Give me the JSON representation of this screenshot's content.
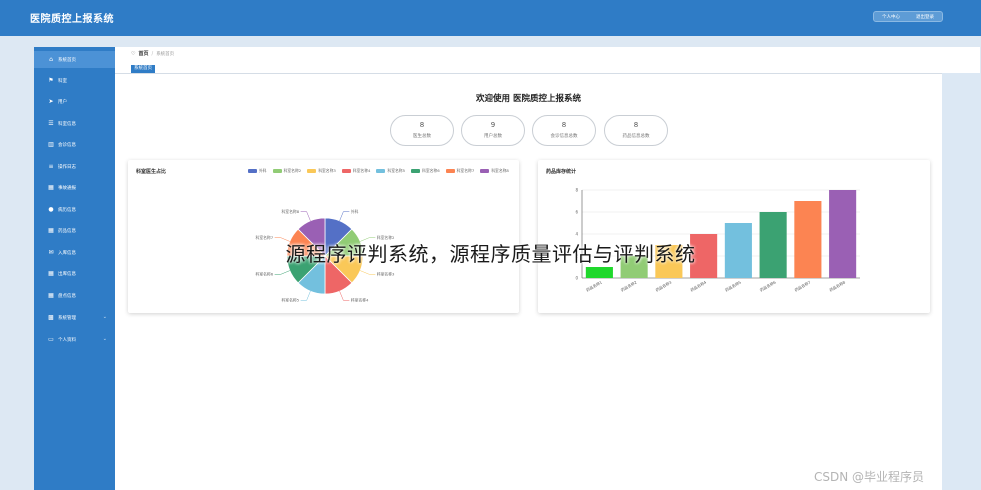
{
  "app": {
    "title": "医院质控上报系统"
  },
  "header": {
    "user_label": "个人中心",
    "logout_label": "退出登录"
  },
  "sidebar": {
    "items": [
      {
        "label": "系统首页",
        "icon": "home-icon"
      },
      {
        "label": "科室",
        "icon": "flag-icon"
      },
      {
        "label": "用户",
        "icon": "send-icon"
      },
      {
        "label": "科室信息",
        "icon": "list-icon"
      },
      {
        "label": "会诊信息",
        "icon": "chart-icon"
      },
      {
        "label": "操作日志",
        "icon": "log-icon"
      },
      {
        "label": "事故通报",
        "icon": "grid-icon"
      },
      {
        "label": "病历信息",
        "icon": "pin-icon"
      },
      {
        "label": "药品信息",
        "icon": "grid-icon"
      },
      {
        "label": "入库信息",
        "icon": "envelope-icon"
      },
      {
        "label": "出库信息",
        "icon": "grid-icon"
      },
      {
        "label": "盘点信息",
        "icon": "grid-icon"
      },
      {
        "label": "系统管理",
        "icon": "apps-icon"
      },
      {
        "label": "个人资料",
        "icon": "card-icon"
      }
    ]
  },
  "breadcrumb": {
    "home": "首页",
    "current": "系统首页"
  },
  "tab": {
    "label": "系统首页"
  },
  "welcome": "欢迎使用 医院质控上报系统",
  "stats": [
    {
      "value": "8",
      "label": "医生总数"
    },
    {
      "value": "9",
      "label": "用户总数"
    },
    {
      "value": "8",
      "label": "会诊信息总数"
    },
    {
      "value": "8",
      "label": "药品信息总数"
    }
  ],
  "colors": {
    "primary": "#2f7cc6",
    "series": [
      "#5470c6",
      "#91cc75",
      "#fac858",
      "#ee6666",
      "#73c0de",
      "#3ba272",
      "#fc8452",
      "#9a60b4"
    ]
  },
  "chart_data": [
    {
      "type": "pie",
      "title": "科室医生占比",
      "categories": [
        "外科",
        "科室名称2",
        "科室名称3",
        "科室名称4",
        "科室名称5",
        "科室名称6",
        "科室名称7",
        "科室名称8"
      ],
      "values": [
        1,
        1,
        1,
        1,
        1,
        1,
        1,
        1
      ],
      "slice_labels": [
        "外科",
        "科室名称2",
        "科室名称3",
        "科室名称4",
        "科室名称5",
        "科室名称6",
        "科室名称7",
        "科室名称8"
      ],
      "legend": "top-right"
    },
    {
      "type": "bar",
      "title": "药品库存统计",
      "categories": [
        "药品名称1",
        "药品名称2",
        "药品名称3",
        "药品名称4",
        "药品名称5",
        "药品名称6",
        "药品名称7",
        "药品名称8"
      ],
      "values": [
        1,
        2,
        3,
        4,
        5,
        6,
        7,
        8
      ],
      "ylim": [
        0,
        8
      ],
      "yticks": [
        "0",
        "2",
        "4",
        "6",
        "8"
      ],
      "grid": true
    }
  ],
  "overlay": {
    "caption": "源程序评判系统，源程序质量评估与评判系统",
    "corner": "CSDN @毕业程序员"
  }
}
